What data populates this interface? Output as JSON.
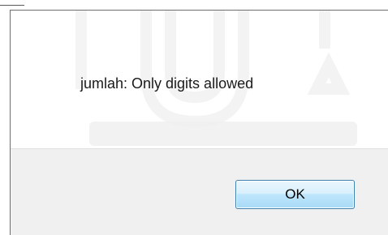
{
  "dialog": {
    "message": "jumlah: Only digits allowed",
    "ok_label": "OK"
  },
  "colors": {
    "button_border": "#3c7fb1",
    "footer_bg": "#f0f0f0",
    "watermark": "#d9d9d9"
  }
}
